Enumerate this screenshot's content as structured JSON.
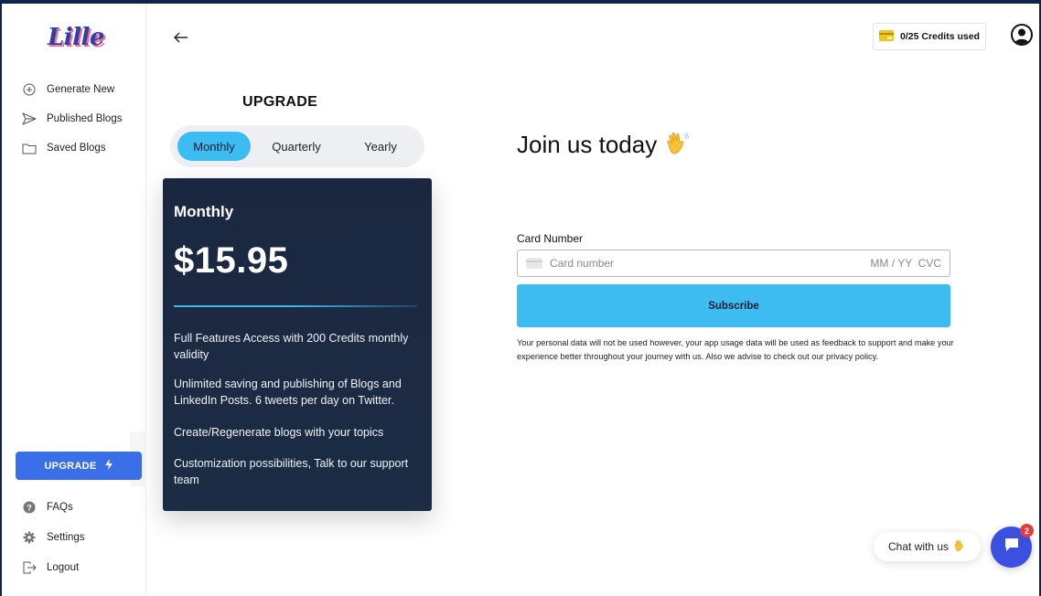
{
  "app": {
    "logo_text": "Lille"
  },
  "sidebar": {
    "items": [
      {
        "label": "Generate New",
        "icon": "plus-circle-icon"
      },
      {
        "label": "Published Blogs",
        "icon": "send-icon"
      },
      {
        "label": "Saved Blogs",
        "icon": "folder-icon"
      }
    ],
    "upgrade_label": "UPGRADE",
    "bottom_items": [
      {
        "label": "FAQs",
        "icon": "help-icon"
      },
      {
        "label": "Settings",
        "icon": "gear-icon"
      },
      {
        "label": "Logout",
        "icon": "logout-icon"
      }
    ]
  },
  "header": {
    "credits_label": "0/25 Credits used"
  },
  "upgrade": {
    "title": "UPGRADE",
    "tabs": [
      {
        "label": "Monthly",
        "active": true
      },
      {
        "label": "Quarterly",
        "active": false
      },
      {
        "label": "Yearly",
        "active": false
      }
    ],
    "plan": {
      "name": "Monthly",
      "price": "$15.95",
      "features": [
        "Full Features Access with 200 Credits monthly validity",
        "Unlimited saving and publishing of Blogs and LinkedIn Posts. 6 tweets per day on Twitter.",
        "Create/Regenerate blogs with your topics",
        "Customization possibilities, Talk to our support team"
      ]
    }
  },
  "checkout": {
    "title": "Join us today",
    "card_label": "Card Number",
    "card_placeholder": "Card number",
    "card_suffix": "MM / YY  CVC",
    "subscribe_label": "Subscribe",
    "disclaimer": "Your personal data will not be used however, your app usage data will be used as feedback to support and make your experience better throughout your journey with us. Also we advise to check out our privacy policy."
  },
  "chat": {
    "label": "Chat with us",
    "badge": "2"
  },
  "colors": {
    "accent": "#3dbcf2",
    "upgrade_button": "#3b6fe8",
    "card_bg": "#1b2740",
    "chat_fab": "#3b4fe0"
  }
}
